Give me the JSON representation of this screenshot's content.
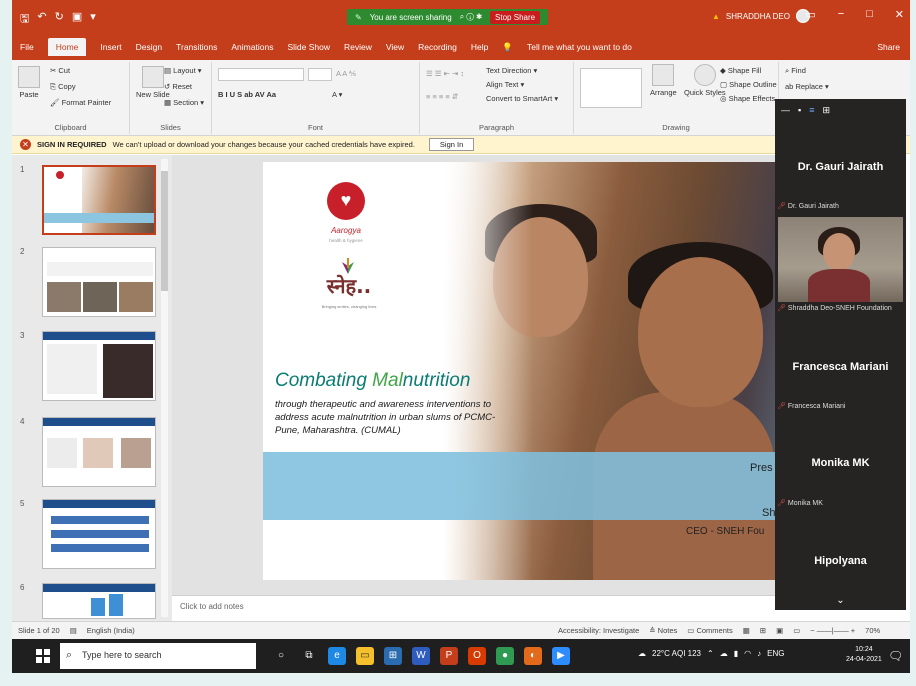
{
  "titlebar": {
    "share_status": "You are screen sharing",
    "stop_share": "Stop Share",
    "user_name": "SHRADDHA DEO"
  },
  "menu": {
    "tabs": [
      "File",
      "Home",
      "Insert",
      "Design",
      "Transitions",
      "Animations",
      "Slide Show",
      "Review",
      "View",
      "Recording",
      "Help"
    ],
    "tell_me": "Tell me what you want to do",
    "share": "Share"
  },
  "ribbon": {
    "clipboard": {
      "paste": "Paste",
      "cut": "Cut",
      "copy": "Copy",
      "format_painter": "Format Painter",
      "label": "Clipboard"
    },
    "slides": {
      "new_slide": "New Slide",
      "layout": "Layout",
      "reset": "Reset",
      "section": "Section",
      "label": "Slides"
    },
    "font": {
      "label": "Font"
    },
    "paragraph": {
      "text_direction": "Text Direction",
      "align_text": "Align Text",
      "convert_smartart": "Convert to SmartArt",
      "label": "Paragraph"
    },
    "drawing": {
      "arrange": "Arrange",
      "quick_styles": "Quick Styles",
      "shape_fill": "Shape Fill",
      "shape_outline": "Shape Outline",
      "shape_effects": "Shape Effects",
      "label": "Drawing"
    },
    "editing": {
      "find": "Find",
      "replace": "Replace"
    }
  },
  "signin_bar": {
    "label": "SIGN IN REQUIRED",
    "message": "We can't upload or download your changes because your cached credentials have expired.",
    "button": "Sign In"
  },
  "thumbnails": [
    "1",
    "2",
    "3",
    "4",
    "5",
    "6"
  ],
  "slide": {
    "logo_name": "Aarogya",
    "logo_sub": "health & hygiene",
    "sneh_logo": "स्नेह..",
    "sneh_tag": "Bringing smiles, changing lives",
    "title_part1": "Combating ",
    "title_part2": "Mal",
    "title_part3": "nutrition",
    "subtitle": "through therapeutic and awareness interventions to address acute malnutrition in urban slums of PCMC- Pune, Maharashtra. (CUMAL)",
    "pres": "Pres",
    "presenter": "Shrad",
    "presenter_role": "CEO - SNEH Fou"
  },
  "notes": "Click to add notes",
  "meeting": {
    "participants": [
      {
        "display": "Dr. Gauri Jairath",
        "label": "Dr. Gauri Jairath"
      },
      {
        "display": "",
        "label": "Shraddha Deo-SNEH Foundation"
      },
      {
        "display": "Francesca Mariani",
        "label": "Francesca Mariani"
      },
      {
        "display": "Monika MK",
        "label": "Monika MK"
      },
      {
        "display": "Hipolyana",
        "label": ""
      }
    ]
  },
  "statusbar": {
    "slide_count": "Slide 1 of 20",
    "language": "English (India)",
    "accessibility": "Accessibility: Investigate",
    "notes": "Notes",
    "comments": "Comments",
    "zoom": "70%"
  },
  "taskbar": {
    "search_placeholder": "Type here to search",
    "weather": "22°C AQI 123",
    "lang": "ENG",
    "time": "10:24",
    "date": "24-04-2021"
  }
}
